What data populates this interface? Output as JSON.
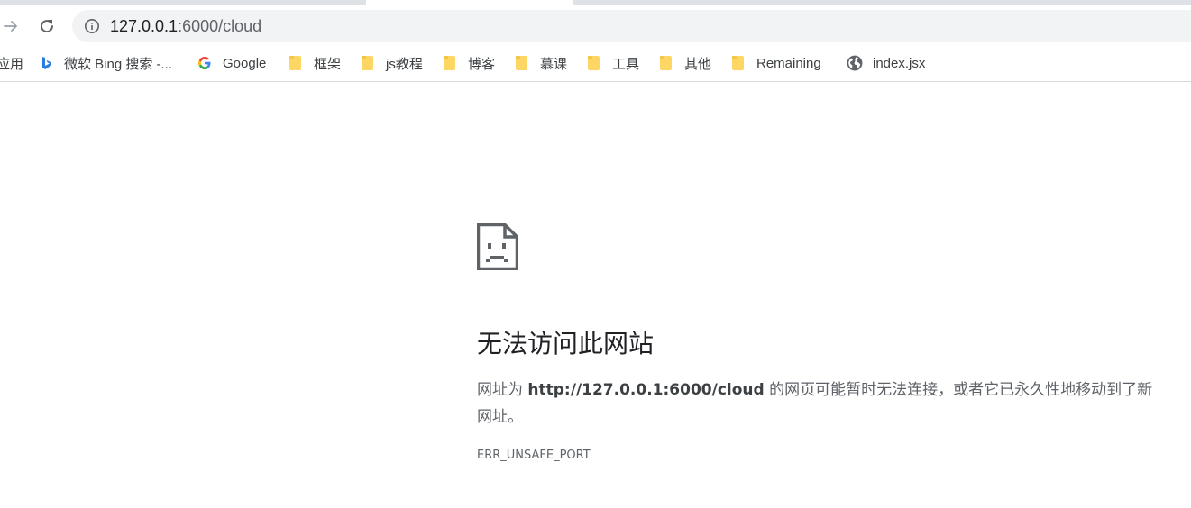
{
  "toolbar": {
    "back_icon": "arrow-back-icon",
    "reload_icon": "reload-icon",
    "url_host": "127.0.0.1",
    "url_path": ":6000/cloud"
  },
  "bookmarks": [
    {
      "label": "应用",
      "icon": "apps-icon"
    },
    {
      "label": "微软 Bing 搜索 -...",
      "icon": "bing-icon"
    },
    {
      "label": "Google",
      "icon": "google-icon"
    },
    {
      "label": "框架",
      "icon": "folder-icon"
    },
    {
      "label": "js教程",
      "icon": "folder-icon"
    },
    {
      "label": "博客",
      "icon": "folder-icon"
    },
    {
      "label": "慕课",
      "icon": "folder-icon"
    },
    {
      "label": "工具",
      "icon": "folder-icon"
    },
    {
      "label": "其他",
      "icon": "folder-icon"
    },
    {
      "label": "Remaining",
      "icon": "folder-icon"
    },
    {
      "label": "index.jsx",
      "icon": "globe-icon"
    }
  ],
  "error": {
    "title": "无法访问此网站",
    "desc_prefix": "网址为 ",
    "desc_url": "http://127.0.0.1:6000/cloud",
    "desc_suffix": " 的网页可能暂时无法连接，或者它已永久性地移动到了新网址。",
    "code": "ERR_UNSAFE_PORT"
  },
  "colors": {
    "folder": "#fdd663",
    "bing": "#2a7de1",
    "omnibox_bg": "#f1f3f4",
    "text_primary": "#202124",
    "text_secondary": "#5f6368"
  }
}
